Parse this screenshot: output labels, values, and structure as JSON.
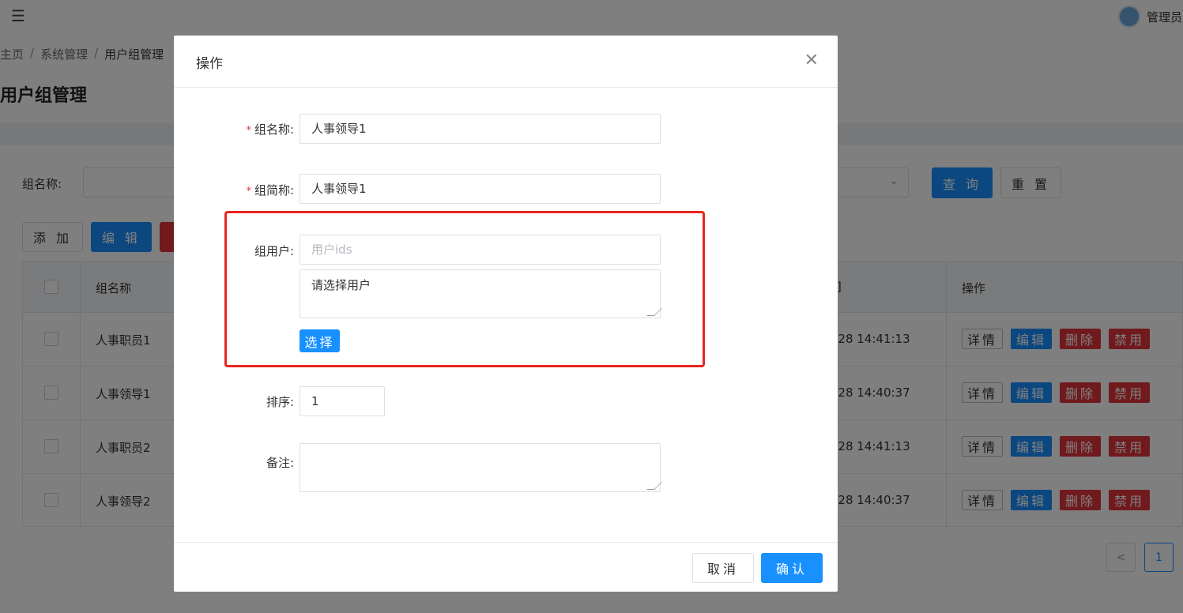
{
  "header": {
    "menu_icon": "menu-fold-icon",
    "user_name": "管理员"
  },
  "breadcrumb": {
    "items": [
      "主页",
      "系统管理",
      "用户组管理"
    ],
    "separator": "/"
  },
  "page_title": "用户组管理",
  "search": {
    "label": "组名称:",
    "query_label": "查 询",
    "reset_label": "重 置"
  },
  "toolbar": {
    "add_label": "添 加",
    "edit_label": "编 辑"
  },
  "table": {
    "headers": {
      "name": "组名称",
      "time": "]",
      "ops": "操作"
    },
    "rows": [
      {
        "name": "人事职员1",
        "time": "-28 14:41:13"
      },
      {
        "name": "人事领导1",
        "time": "-28 14:40:37"
      },
      {
        "name": "人事职员2",
        "time": "-28 14:41:13"
      },
      {
        "name": "人事领导2",
        "time": "-28 14:40:37"
      }
    ],
    "ops": {
      "detail": "详情",
      "edit": "编辑",
      "delete": "删除",
      "disable": "禁用"
    }
  },
  "pager": {
    "prev": "<",
    "current": "1"
  },
  "modal": {
    "title": "操作",
    "fields": {
      "group_name": {
        "label": "组名称:",
        "value": "人事领导1"
      },
      "group_short": {
        "label": "组简称:",
        "value": "人事领导1"
      },
      "group_users": {
        "label": "组用户:",
        "ids_placeholder": "用户ids",
        "select_placeholder": "请选择用户",
        "select_button": "选择"
      },
      "sort": {
        "label": "排序:",
        "value": "1"
      },
      "remark": {
        "label": "备注:",
        "value": ""
      }
    },
    "footer": {
      "cancel_label": "取消",
      "ok_label": "确认"
    },
    "required_mark": "*"
  },
  "colors": {
    "primary": "#1890ff",
    "danger": "#e0353b",
    "highlight": "#e8261f"
  }
}
